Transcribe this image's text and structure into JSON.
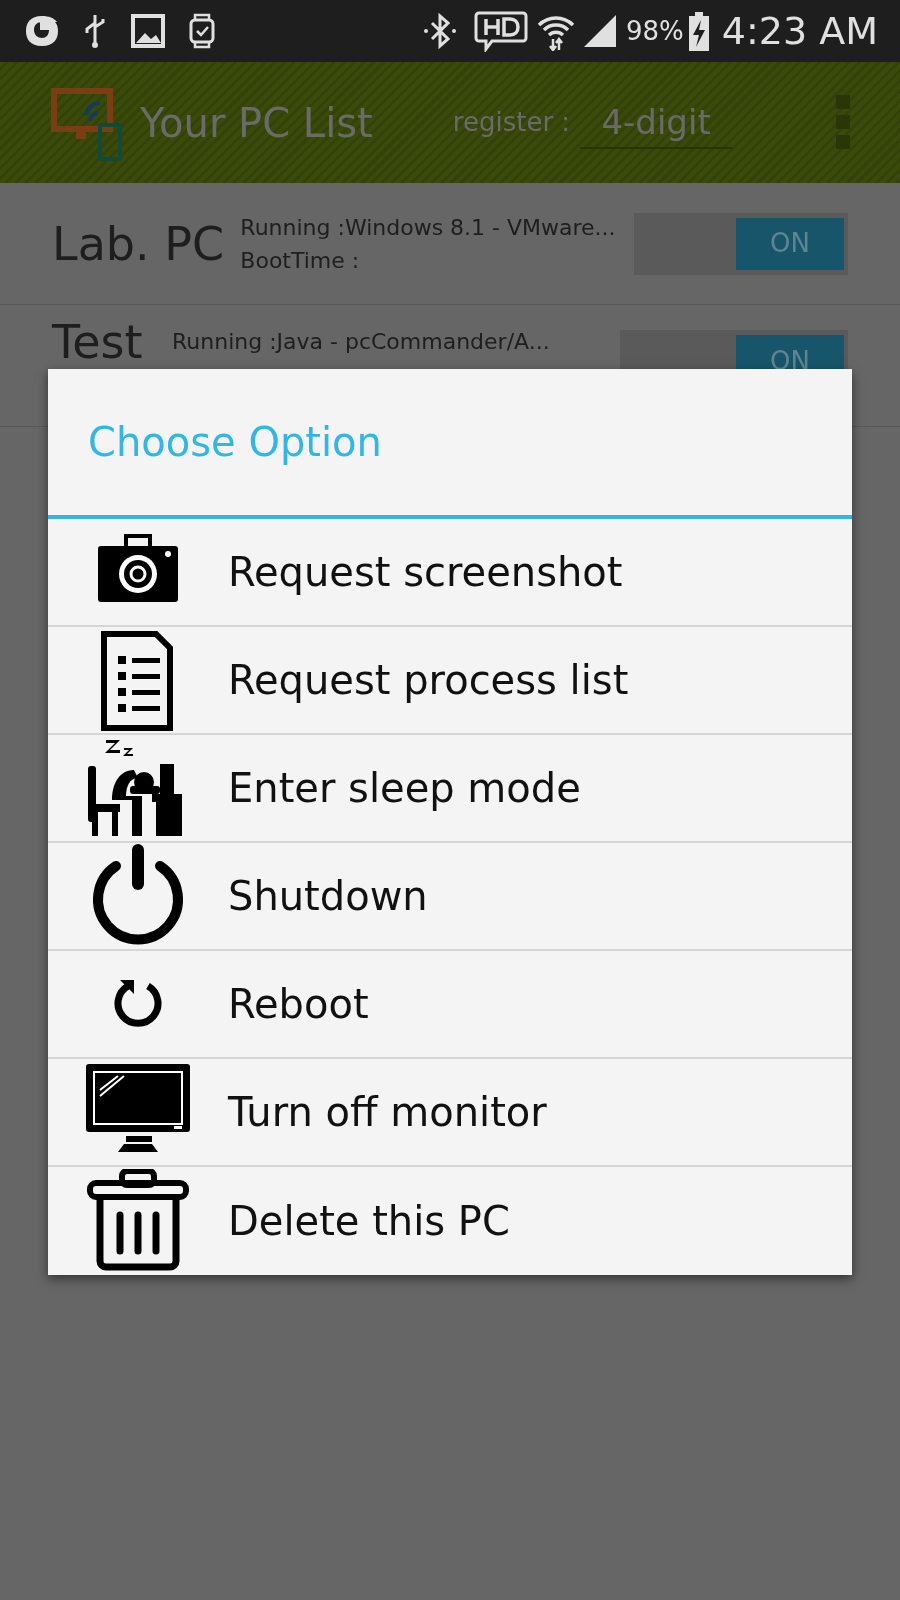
{
  "status_bar": {
    "battery": "98%",
    "time": "4:23 AM"
  },
  "app_bar": {
    "title": "Your PC List",
    "register_label": "register :",
    "register_placeholder": "4-digit"
  },
  "pcs": [
    {
      "name": "Lab. PC",
      "running": "Running :Windows 8.1 - VMware...",
      "boot_time": "BootTime :",
      "switch": {
        "on": true,
        "label": "ON"
      }
    },
    {
      "name": "Test",
      "running": "Running :Java - pcCommander/A...",
      "switch": {
        "on": true,
        "label": "ON"
      }
    }
  ],
  "dialog": {
    "title": "Choose Option",
    "options": [
      {
        "label": "Request screenshot"
      },
      {
        "label": "Request process list"
      },
      {
        "label": "Enter sleep mode"
      },
      {
        "label": "Shutdown"
      },
      {
        "label": "Reboot"
      },
      {
        "label": "Turn off monitor"
      },
      {
        "label": "Delete this PC"
      }
    ]
  }
}
